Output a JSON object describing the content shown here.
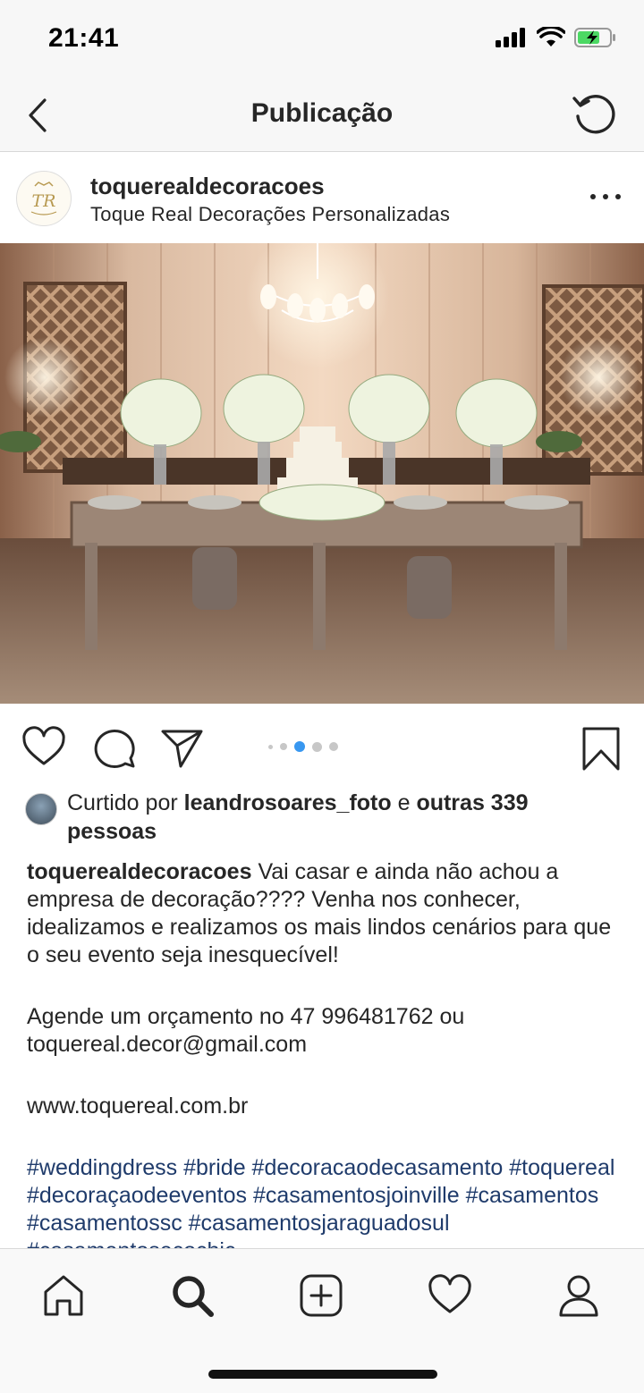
{
  "status_bar": {
    "time": "21:41"
  },
  "header": {
    "title": "Publicação"
  },
  "post": {
    "username": "toquerealdecoracoes",
    "location": "Toque Real Decorações Personalizadas",
    "avatar_initials": "TR",
    "carousel": {
      "count": 5,
      "active_index": 2
    }
  },
  "likes": {
    "prefix": "Curtido por ",
    "user": "leandrosoares_foto",
    "joiner": " e ",
    "others": "outras 339 pessoas"
  },
  "caption": {
    "username": "toquerealdecoracoes",
    "text1": " Vai casar e ainda não achou a empresa de decoração???? Venha nos conhecer, idealizamos e realizamos os mais lindos cenários para que o seu evento seja inesquecível!",
    "text2": "Agende um orçamento no 47 996481762 ou toquereal.decor@gmail.com",
    "text3": "www.toquereal.com.br",
    "hashtags": "#weddingdress #bride #decoracaodecasamento #toquereal #decoraçaodeeventos #casamentosjoinville #casamentos #casamentossc #casamentosjaraguadosul #casamentosecochic"
  },
  "icons": {
    "back": "chevron-left-icon",
    "refresh": "refresh-icon",
    "more": "more-horizontal-icon",
    "like": "heart-icon",
    "comment": "comment-bubble-icon",
    "share": "paper-plane-icon",
    "save": "bookmark-icon",
    "tabs": [
      "home-icon",
      "search-icon",
      "add-icon",
      "activity-heart-icon",
      "profile-icon"
    ]
  },
  "colors": {
    "accent": "#3897f0",
    "hashtag": "#1f3b6b",
    "text": "#262626"
  }
}
